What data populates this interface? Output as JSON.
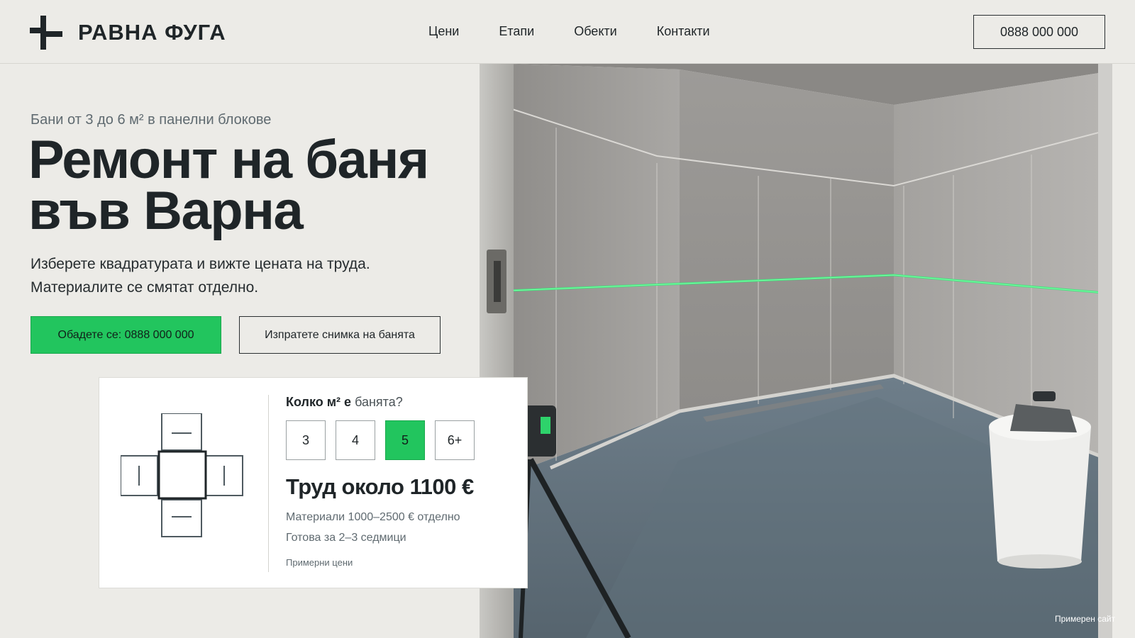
{
  "brand": {
    "name": "РАВНА ФУГА",
    "accent_color": "#22c55e",
    "text_color": "#1f2528"
  },
  "nav": [
    {
      "label": "Цени"
    },
    {
      "label": "Етапи"
    },
    {
      "label": "Обекти"
    },
    {
      "label": "Контакти"
    }
  ],
  "header": {
    "phone_label": "0888 000 000"
  },
  "hero": {
    "eyebrow": "Бани от 3 до 6 м² в панелни блокове",
    "title_line1": "Ремонт на баня",
    "title_line2": "във Варна",
    "lead_line1": "Изберете квадратурата и вижте цената на труда.",
    "lead_line2": "Материалите се смятат отделно.",
    "cta_call": "Обадете се: 0888 000 000",
    "cta_photo": "Изпратете снимка на банята"
  },
  "calculator": {
    "question_bold": "Колко м² е",
    "question_rest": "банята?",
    "options": [
      "3",
      "4",
      "5",
      "6+"
    ],
    "selected": "5",
    "price": "Труд около 1100 €",
    "materials": "Материали 1000–2500 € отделно",
    "duration": "Готова за 2–3 седмици",
    "note": "Примерни цени",
    "diagram_icon": "room-floorplan-icon"
  },
  "footer": {
    "example_label": "Примерен сайт"
  }
}
